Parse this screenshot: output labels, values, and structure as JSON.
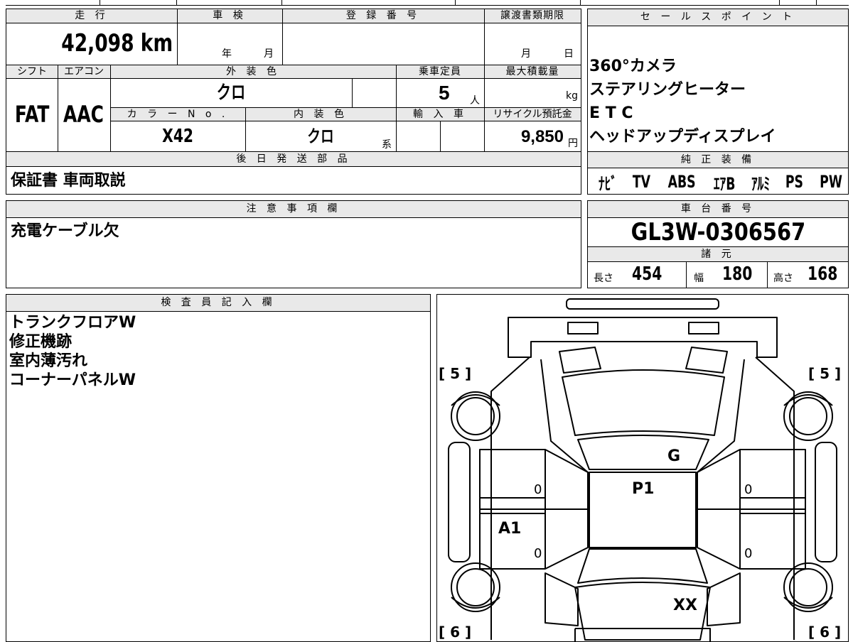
{
  "top_block": {
    "headers": {
      "mileage": "走 行",
      "inspection": "車 検",
      "registration": "登 録 番 号",
      "transfer_deadline": "譲渡書類期限",
      "shift": "シフト",
      "aircon": "エアコン",
      "exterior_color": "外 装 色",
      "capacity": "乗車定員",
      "max_load": "最大積載量",
      "color_no": "カ ラ ー N o .",
      "interior_color": "内 装 色",
      "import": "輸 入 車",
      "recycle": "リサイクル預託金",
      "later_parts": "後 日 発 送 部 品"
    },
    "mileage_value": "42,098 km",
    "inspection_year_unit": "年",
    "inspection_month_unit": "月",
    "deadline_month_unit": "月",
    "deadline_day_unit": "日",
    "shift_value": "FAT",
    "aircon_value": "AAC",
    "exterior_color_value": "クロ",
    "capacity_value": "5",
    "capacity_unit": "人",
    "max_load_unit": "kg",
    "color_no_value": "X42",
    "interior_color_value": "クロ",
    "interior_color_suffix": "系",
    "recycle_value": "9,850",
    "recycle_unit": "円",
    "later_parts_value": "保証書 車両取説"
  },
  "notes": {
    "header": "注 意 事 項 欄",
    "text": "充電ケーブル欠"
  },
  "sales_points": {
    "header": "セ ー ル ス ポ イ ン ト",
    "items": [
      "360°カメラ",
      "ステアリングヒーター",
      "E T C",
      "ヘッドアップディスプレイ"
    ]
  },
  "equipment": {
    "header": "純 正 装 備",
    "items": [
      "ﾅﾋﾞ",
      "TV",
      "ABS",
      "ｴｱB",
      "ｱﾙﾐ",
      "PS",
      "PW"
    ]
  },
  "chassis": {
    "header": "車 台 番 号",
    "value": "GL3W-0306567"
  },
  "specs": {
    "header": "諸 元",
    "length_label": "長さ",
    "length_value": "454",
    "width_label": "幅",
    "width_value": "180",
    "height_label": "高さ",
    "height_value": "168"
  },
  "inspector": {
    "header": "検 査 員 記 入 欄",
    "lines": [
      "トランクフロアW",
      "修正機跡",
      "室内薄汚れ",
      "コーナーパネルW"
    ]
  },
  "diagram": {
    "tire_front_left": "[ 5 ]",
    "tire_front_right": "[ 5 ]",
    "tire_rear_left": "[ 6 ]",
    "tire_rear_right": "[ 6 ]",
    "mark_g": "G",
    "mark_p1": "P1",
    "mark_a1": "A1",
    "mark_xx": "XX",
    "door_marks": [
      "0",
      "0",
      "0",
      "0"
    ]
  }
}
